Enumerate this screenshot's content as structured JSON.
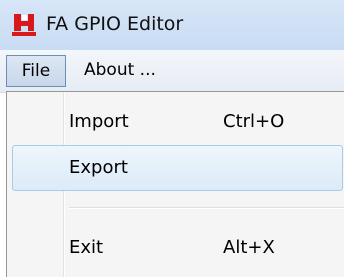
{
  "window": {
    "title": "FA GPIO Editor",
    "icon": "app-logo-icon"
  },
  "menubar": {
    "file_label": "File",
    "about_label": "About ..."
  },
  "file_menu": {
    "items": [
      {
        "label": "Import",
        "shortcut": "Ctrl+O"
      },
      {
        "label": "Export",
        "shortcut": ""
      },
      {
        "label": "Exit",
        "shortcut": "Alt+X"
      }
    ],
    "highlighted_item": "Export"
  },
  "colors": {
    "accent_icon": "#d7191c",
    "highlight_border": "#a8cbe8"
  }
}
